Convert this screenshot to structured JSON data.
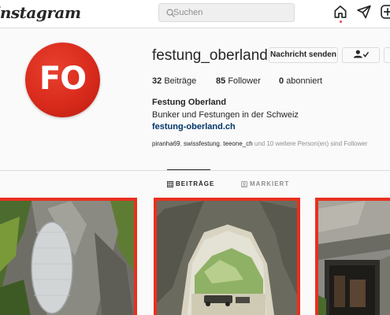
{
  "nav": {
    "logo": "Instagram",
    "search_placeholder": "Suchen"
  },
  "profile": {
    "avatar_text": "FO",
    "username": "festung_oberland",
    "buttons": {
      "message": "Nachricht senden"
    },
    "stats": {
      "posts_count": "32",
      "posts_label": "Beiträge",
      "followers_count": "85",
      "followers_label": "Follower",
      "following_count": "0",
      "following_label": "abonniert"
    },
    "full_name": "Festung Oberland",
    "bio": "Bunker und Festungen in der Schweiz",
    "website": "festung-oberland.ch",
    "followed_by": {
      "names": [
        "piranha69",
        "swissfestung",
        "teeone_ch"
      ],
      "separator": ", ",
      "suffix": " und 10 weitere Person(en) sind Follower"
    }
  },
  "tabs": {
    "posts": "BEITRÄGE",
    "tagged": "MARKIERT"
  },
  "colors": {
    "brand_red": "#e8301f",
    "link_blue": "#00376b",
    "notification_dot": "#ed4956"
  },
  "icons": [
    "search-icon",
    "home-icon",
    "direct-message-icon",
    "add-post-icon",
    "follow-person-icon",
    "grid-icon",
    "tagged-icon"
  ]
}
